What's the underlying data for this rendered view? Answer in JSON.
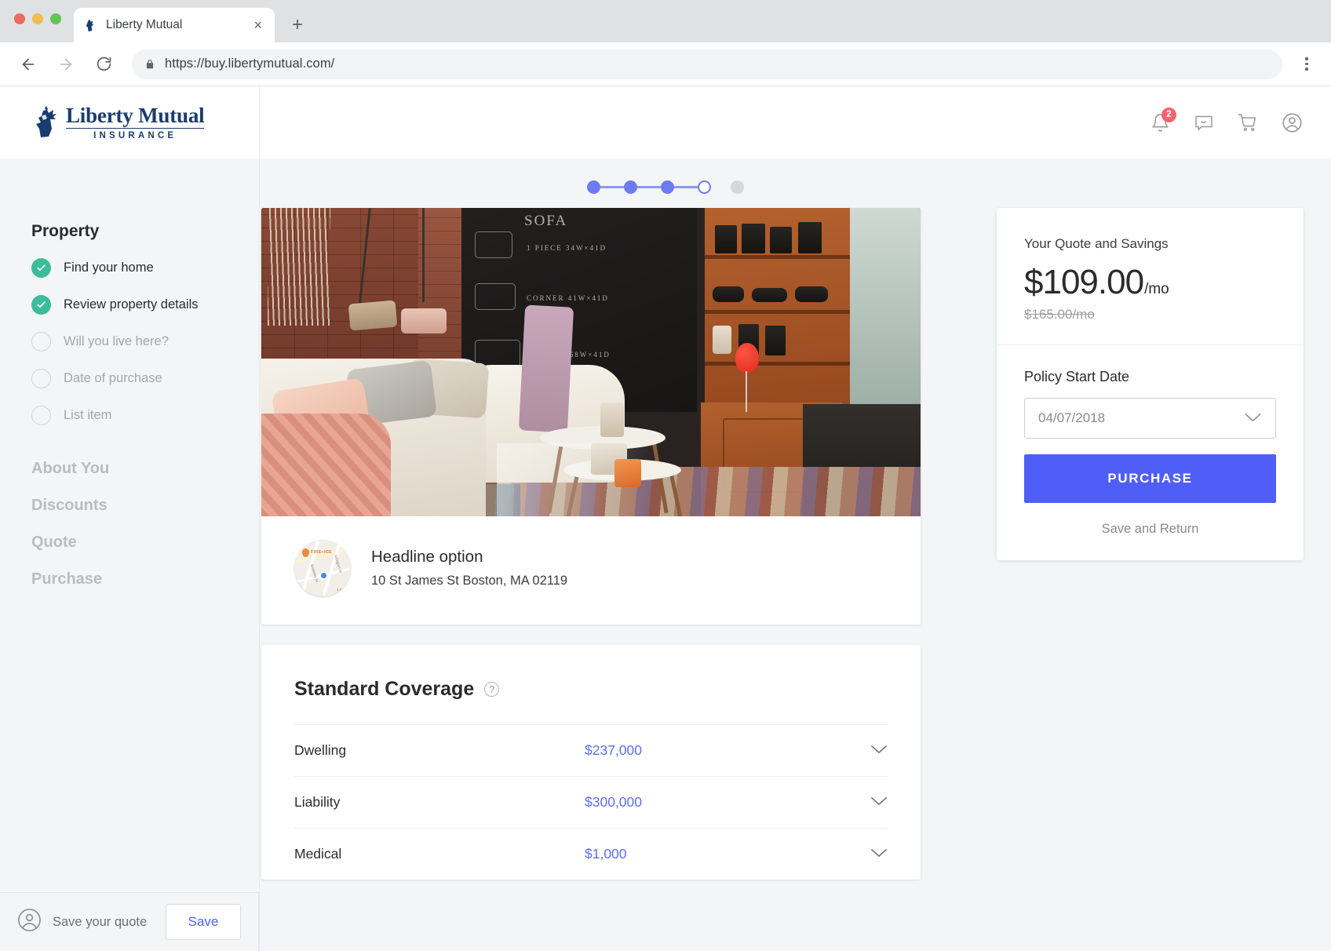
{
  "browser": {
    "tab_title": "Liberty Mutual",
    "tab_close": "×",
    "new_tab": "+",
    "back": "←",
    "forward": "→",
    "reload": "⟳",
    "url": "https://buy.libertymutual.com/"
  },
  "header": {
    "logo_name": "Liberty Mutual",
    "logo_sub": "INSURANCE",
    "notification_count": "2"
  },
  "stepper": {
    "steps": [
      "done",
      "done",
      "done",
      "current",
      "upcoming"
    ]
  },
  "sidebar": {
    "title": "Property",
    "items": [
      {
        "label": "Find your home",
        "state": "done"
      },
      {
        "label": "Review property details",
        "state": "done"
      },
      {
        "label": "Will you live here?",
        "state": "todo"
      },
      {
        "label": "Date of purchase",
        "state": "todo"
      },
      {
        "label": "List item",
        "state": "todo"
      }
    ],
    "sections": [
      "About You",
      "Discounts",
      "Quote",
      "Purchase"
    ]
  },
  "property": {
    "headline": "Headline option",
    "address": "10 St James St Boston, MA 02119",
    "map": {
      "poi_label": "FIRE+ICE",
      "street_1": "Berkeley St",
      "street_2": "Arlington St",
      "scale": "1 km"
    }
  },
  "coverage": {
    "title": "Standard Coverage",
    "help": "?",
    "rows": [
      {
        "name": "Dwelling",
        "value": "$237,000"
      },
      {
        "name": "Liability",
        "value": "$300,000"
      },
      {
        "name": "Medical",
        "value": "$1,000"
      }
    ]
  },
  "quote": {
    "title": "Your Quote and Savings",
    "price": "$109.00",
    "per": "/mo",
    "old_price": "$165.00/mo",
    "date_label": "Policy Start Date",
    "date_value": "04/07/2018",
    "purchase_label": "PURCHASE",
    "save_return_label": "Save and Return"
  },
  "footer": {
    "label": "Save your quote",
    "button": "Save"
  },
  "colors": {
    "brand_navy": "#1b3c6e",
    "accent_indigo": "#4f5ef6",
    "step_blue": "#6c7bf0",
    "check_green": "#3bbd99",
    "badge_red": "#f8626f"
  }
}
